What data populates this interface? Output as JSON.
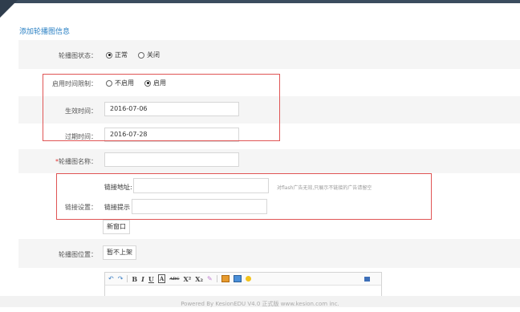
{
  "section_title": "添加轮播图信息",
  "status": {
    "label": "轮播图状态：",
    "options": [
      "正常",
      "关闭"
    ],
    "selected": "正常"
  },
  "time_limit": {
    "label": "启用时间限制：",
    "options": [
      "不启用",
      "启用"
    ],
    "selected": "启用"
  },
  "start_time": {
    "label": "生效时间：",
    "value": "2016-07-06"
  },
  "end_time": {
    "label": "过期时间：",
    "value": "2016-07-28"
  },
  "name": {
    "required_mark": "*",
    "label": "轮播图名称：",
    "value": ""
  },
  "link": {
    "group_label": "链接设置：",
    "address_label": "链接地址:",
    "address_value": "",
    "hint": "对flash广告无效,只展示不链接的广告请留空",
    "tip_label": "链接提示",
    "tip_value": "",
    "target": "新窗口"
  },
  "position": {
    "label": "轮播图位置：",
    "value": "暂不上架"
  },
  "editor": {
    "toolbar": [
      "undo-icon",
      "redo-icon",
      "B",
      "I",
      "U",
      "A",
      "ABC",
      "X²",
      "X₂",
      "eraser-icon",
      "image-icon",
      "flash-icon",
      "emoji-icon",
      "fullscreen-icon"
    ]
  },
  "footer": "Powered By KesionEDU V4.0 正式版 www.kesion.com inc."
}
